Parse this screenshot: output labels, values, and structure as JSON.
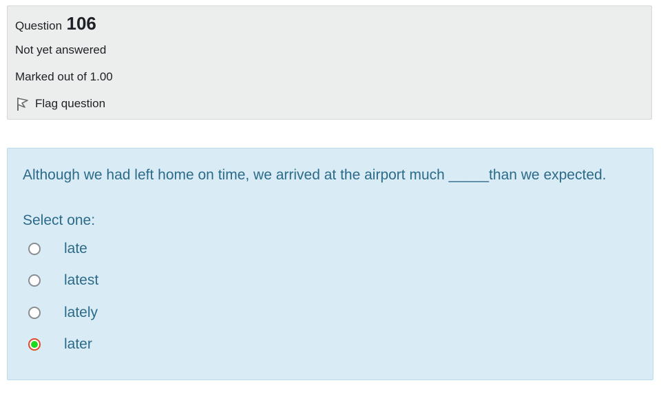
{
  "info": {
    "question_label": "Question",
    "question_number": "106",
    "state": "Not yet answered",
    "grade": "Marked out of 1.00",
    "flag_label": "Flag question"
  },
  "question": {
    "text": "Although we had left home on time, we arrived at the airport much _____than we expected.",
    "prompt": "Select one:",
    "options": [
      {
        "label": "late",
        "selected": false
      },
      {
        "label": "latest",
        "selected": false
      },
      {
        "label": "lately",
        "selected": false
      },
      {
        "label": "later",
        "selected": true
      }
    ]
  },
  "colors": {
    "info_bg": "#eceded",
    "content_bg": "#d9ecf5",
    "content_text": "#2c6a8a",
    "selected_fill": "#1cdb1c",
    "selected_ring": "#e0492a"
  },
  "icons": {
    "flag": "flag-icon"
  }
}
